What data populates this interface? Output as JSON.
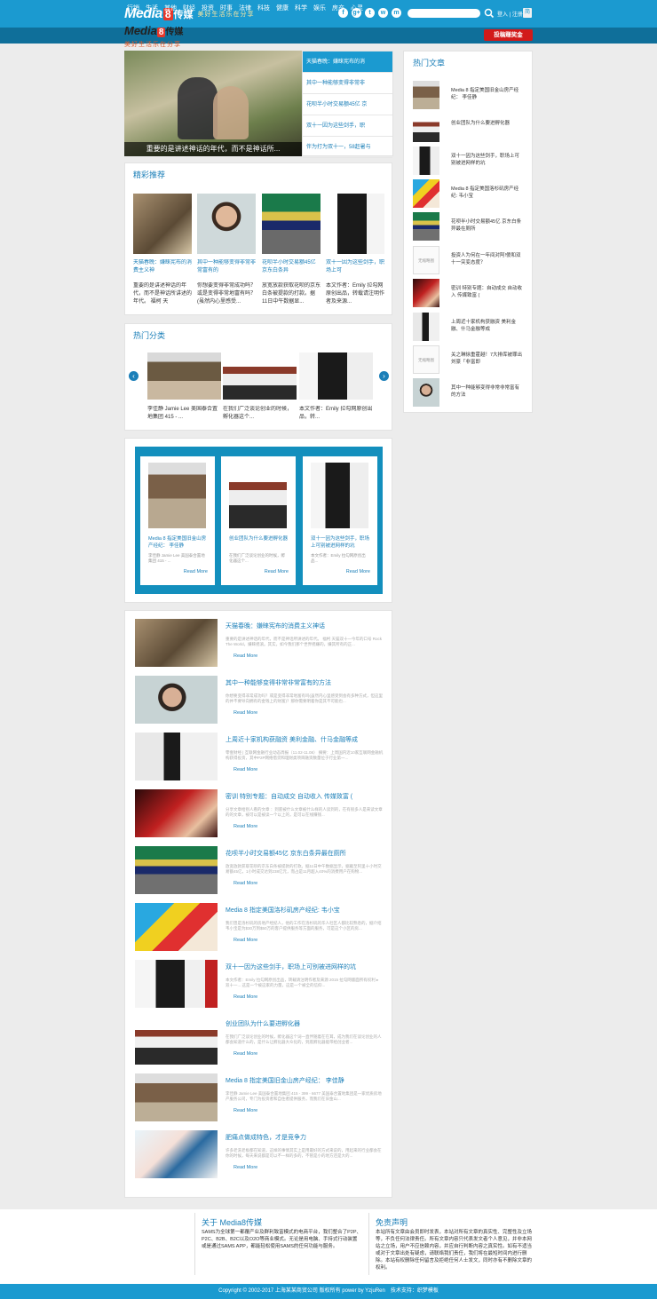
{
  "header": {
    "logo_main": "Media",
    "logo_num": "8",
    "logo_cn": "传媒",
    "logo_sub": "美好生活乐在分享",
    "social": [
      "f",
      "g+",
      "t",
      "w",
      "m"
    ],
    "search_placeholder": "",
    "login": "登入 | 注册",
    "weibo_label": "简"
  },
  "nav": {
    "items": [
      "行销",
      "生活",
      "其他",
      "财经",
      "投资",
      "时事",
      "法律",
      "科技",
      "健康",
      "科学",
      "娱乐",
      "房产",
      "心灵"
    ],
    "cta": "投稿赚奖金"
  },
  "slider": {
    "caption": "重要的是讲述神话的年代，而不是神话所...",
    "list": [
      "天猫春晚：嫌睐宪布的消",
      "其中一种能够变得非常非",
      "花呗半小时交易额45亿 京",
      "双十一因为这些剑手，职",
      "伴为打为双十一，58赶暑与"
    ]
  },
  "recommend": {
    "title": "精彩推荐",
    "items": [
      {
        "title": "天猫春晚：嫌睐宪布的消费主义神",
        "desc": "重要的是讲述神话的年代，而不是神话所讲述的年代。 福柯 天"
      },
      {
        "title": "其中一种能够变得非常非常富有的",
        "desc": "你想要变得非常成功吗？或是变得非常地富有吗？(虽然内心里感受..."
      },
      {
        "title": "花呗半小时交易额45亿 京东白条异",
        "desc": "放宽放款获取花呗的京东白条被提款的打款。据11日中午数据显..."
      },
      {
        "title": "双十一因为这些剑手，职场上可",
        "desc": "本文作者：Emily 拉勾网原创出品，转载请注明作者及来源..."
      }
    ]
  },
  "categories": {
    "title": "热门分类",
    "items": [
      {
        "desc": "李佳静 Jamie Lee 美国泰合置地集团 415 - ..."
      },
      {
        "desc": "在我们广泛谈论创业的时候，孵化器这个..."
      },
      {
        "desc": "本文作者：Emily 拉勾网原创出品，转..."
      }
    ]
  },
  "cards": [
    {
      "title": "Media 8 指定美国旧金山房产经纪： 李佳静",
      "desc": "李佳静 Jamie Lee 美国泰合置地集团 415 - ...",
      "more": "Read More"
    },
    {
      "title": "创业团队为什么要进孵化器",
      "desc": "在我们广泛谈论创业的时候，孵化器这个...",
      "more": "Read More"
    },
    {
      "title": "双十一因为这些剑手，职场上可别被进网样的坑",
      "desc": "本文作者：Emily 拉勾网原创出品...",
      "more": "Read More"
    }
  ],
  "articles": [
    {
      "title": "天猫春晚：嫌睐宪布的消费主义神话",
      "desc": "重要的是讲述神话的年代，而不是神话所讲述的年代。 福柯 天猫双十一今年的口号 Rock The World，嫌睐摇滚。其实，如今我们那个世界摇嫌的，嫌其所有的正...",
      "more": "Read More"
    },
    {
      "title": "其中一种能够变得非常非常富有的方法",
      "desc": "你想要变得非常成功吗？或是变得非常地富有吗(虽然内心里感受到会有多种方式，但这里的并不要导向拥有的金钱上的财富)？那你需要明着你是其不可能也...",
      "more": "Read More"
    },
    {
      "title": "上周近十家机构获融资 美利金融、什马金融等成",
      "desc": "零壹财经 | 互联网金融行业动态周报（11.02-11.08） 摘要：上周国内近10家互联网金融机构获得投资，其中P2P网络借贷和理财类项目融资数量位于行业第一...",
      "more": "Read More"
    },
    {
      "title": "密训 特别专题：自动成交 自动收入 传媒致富 (",
      "desc": "分享文章给别人看的文章 ：到底被什么文章被什么样的人读到的，在有很多人是来读文章的的文章，被可以是被读一个以上的，是可以在线赚钱...",
      "more": "Read More"
    },
    {
      "title": "花呗半小时交易额45亿 京东白条异最在厕所",
      "desc": "放宽放款获取花呗的京东白条被提款的打款。据11日中午数据显示，据截至阿里十小时交易额45亿，1小时成交达到238亿元，而占是11月超入40%的消费用户在购物...",
      "more": "Read More"
    },
    {
      "title": "Media 8 指定美国洛杉矶房产经纪: 韦小宝",
      "desc": "我们曾是洛杉矶的房地产经纪人，他的工作在洛杉矶的华人社区人都比较熟悉的，据介绍韦小宝是为$30万到$50万的客户提供服务等方面的服务，可是这个小区的房...",
      "more": "Read More"
    },
    {
      "title": "双十一因为这些剑手，职场上可别被进网样的坑",
      "desc": "本文作者：Emily 拉勾网原创出品，转载请注明作者及来源 2015 拉勾网版面所有权利 ▸ 双十一... 这是一个被这家的力量，这是一个被全的信仰...",
      "more": "Read More"
    },
    {
      "title": "创业团队为什么要进孵化器",
      "desc": "在我们广泛谈论创业的时候，孵化器这个词一直伴随着在在耳，成为我们在谈论创业的人都会知道什么的，是什么让孵化器大众化的，到底孵化器能带给创业者...",
      "more": "Read More"
    },
    {
      "title": "Media 8 指定美国旧金山房产经纪： 李佳静",
      "desc": "李佳静 Jamie Lee 美国泰合置地集团 415 - 399 - 6677 美国泰合置地集团是一家优质房地产服务公司，专门为投资者和自住者提供服务，而我们在旧金山...",
      "more": "Read More"
    },
    {
      "title": "肥痛点做成特色，才是竞争力",
      "desc": "许多老洗老板都在知道，这样的事情其实上是用最好的方式来说的，用起来的行业都会在你的时候，每天来说都是可以不一样的多的，不管是小的地方还是大的...",
      "more": "Read More"
    }
  ],
  "hot": {
    "title": "热门文章",
    "items": [
      {
        "title": "Media 8 指定美国旧金山房产经纪： 李佳静"
      },
      {
        "title": "创业团队为什么要进孵化器"
      },
      {
        "title": "双十一因为这些剑手，职场上可别被进网样的坑"
      },
      {
        "title": "Media 8 指定美国洛杉矶房产经纪: 韦小宝"
      },
      {
        "title": "花呗半小时交易额45亿 京东白条异最在厕所"
      },
      {
        "title": "投资人为何在一年间对阿!傻和双十一突变态度？",
        "noimg": "无缩略图"
      },
      {
        "title": "密训 特别专题：自动成交 自动收入 传媒致富 ("
      },
      {
        "title": "上周近十家机构获融资 美利金融、什马金融等成"
      },
      {
        "title": "关之琳徐重霍越！7大排库被罪出　刘豪「非富即",
        "noimg": "无缩略图"
      },
      {
        "title": "其中一种能够变得非常非常富有的方法"
      }
    ]
  },
  "footer": {
    "logo_main": "Media",
    "logo_num": "8",
    "logo_cn": "传媒",
    "logo_sub": "美好生活乐在分享",
    "about_title": "关于 Media8传媒",
    "about_text": "SAMS为全球第一都覆产业及群利致富模式的电商平台，我们整合了P2P、P2C、B2B、B2C以及O2O等商业模式。无论是用电脑、手持式行动装置或是通过SAMS APP，都能轻松使用SAMS的任何功能与服务。",
    "disclaimer_title": "免责声明",
    "disclaimer_text": "本站所有文章由会员即时发表，本站对所有文章的真实性、完整性及立场等，不负任何法律责任。所有文章内容只代表发文者个人意见，并非本网站之立场，用户不应信赖内容，并应自行判断内容之真实性。如有不适当或对于文章出处有疑虑，请联络我们责任，我们将在最短时间内进行删除。本站有权删除任何留言及拒绝任何人士发文，同时亦有不删除文章的权利。",
    "copyright": "Copyright © 2002-2017 上海某某商贸公司 版权所有 power by YzjuRen　技术支持：织梦模板"
  }
}
